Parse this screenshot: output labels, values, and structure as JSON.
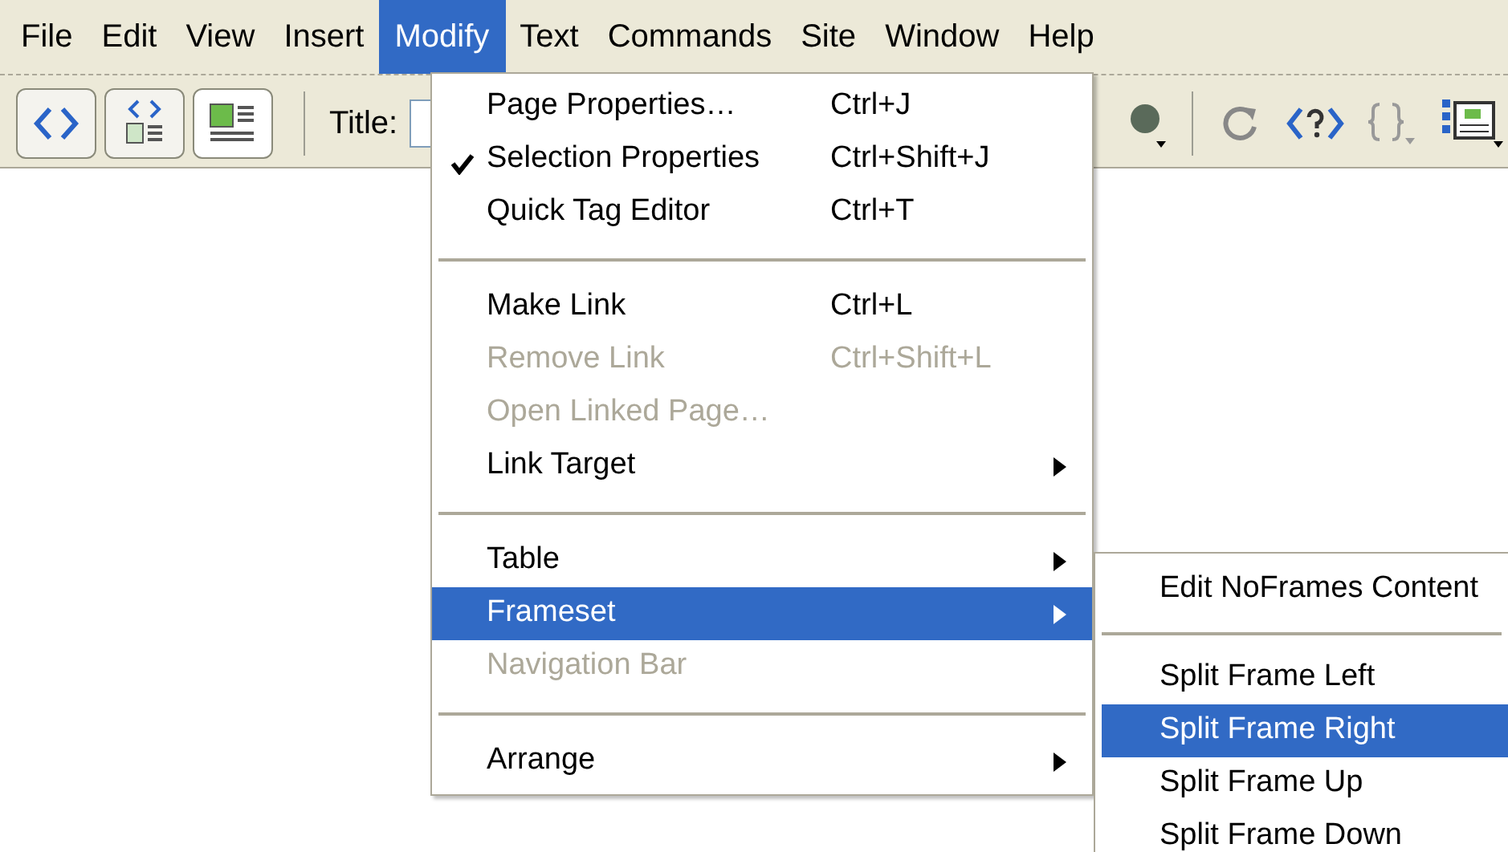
{
  "menu_bar": [
    {
      "label": "File",
      "selected": false
    },
    {
      "label": "Edit",
      "selected": false
    },
    {
      "label": "View",
      "selected": false
    },
    {
      "label": "Insert",
      "selected": false
    },
    {
      "label": "Modify",
      "selected": true
    },
    {
      "label": "Text",
      "selected": false
    },
    {
      "label": "Commands",
      "selected": false
    },
    {
      "label": "Site",
      "selected": false
    },
    {
      "label": "Window",
      "selected": false
    },
    {
      "label": "Help",
      "selected": false
    }
  ],
  "toolbar": {
    "title_label": "Title:"
  },
  "modify_menu": [
    {
      "kind": "item",
      "label": "Page Properties…",
      "shortcut": "Ctrl+J",
      "checked": false,
      "disabled": false,
      "selected": false,
      "submenu": false
    },
    {
      "kind": "item",
      "label": "Selection Properties",
      "shortcut": "Ctrl+Shift+J",
      "checked": true,
      "disabled": false,
      "selected": false,
      "submenu": false
    },
    {
      "kind": "item",
      "label": "Quick Tag Editor",
      "shortcut": "Ctrl+T",
      "checked": false,
      "disabled": false,
      "selected": false,
      "submenu": false
    },
    {
      "kind": "separator"
    },
    {
      "kind": "item",
      "label": "Make Link",
      "shortcut": "Ctrl+L",
      "checked": false,
      "disabled": false,
      "selected": false,
      "submenu": false
    },
    {
      "kind": "item",
      "label": "Remove Link",
      "shortcut": "Ctrl+Shift+L",
      "checked": false,
      "disabled": true,
      "selected": false,
      "submenu": false
    },
    {
      "kind": "item",
      "label": "Open Linked Page…",
      "checked": false,
      "disabled": true,
      "selected": false,
      "submenu": false
    },
    {
      "kind": "item",
      "label": "Link Target",
      "checked": false,
      "disabled": false,
      "selected": false,
      "submenu": true
    },
    {
      "kind": "separator"
    },
    {
      "kind": "item",
      "label": "Table",
      "checked": false,
      "disabled": false,
      "selected": false,
      "submenu": true
    },
    {
      "kind": "item",
      "label": "Frameset",
      "checked": false,
      "disabled": false,
      "selected": true,
      "submenu": true
    },
    {
      "kind": "item",
      "label": "Navigation Bar",
      "checked": false,
      "disabled": true,
      "selected": false,
      "submenu": false
    },
    {
      "kind": "separator"
    },
    {
      "kind": "item",
      "label": "Arrange",
      "checked": false,
      "disabled": false,
      "selected": false,
      "submenu": true
    }
  ],
  "frameset_submenu": [
    {
      "kind": "item",
      "label": "Edit NoFrames Content",
      "selected": false
    },
    {
      "kind": "separator"
    },
    {
      "kind": "item",
      "label": "Split Frame Left",
      "selected": false
    },
    {
      "kind": "item",
      "label": "Split Frame Right",
      "selected": true
    },
    {
      "kind": "item",
      "label": "Split Frame Up",
      "selected": false
    },
    {
      "kind": "item",
      "label": "Split Frame Down",
      "selected": false
    }
  ]
}
